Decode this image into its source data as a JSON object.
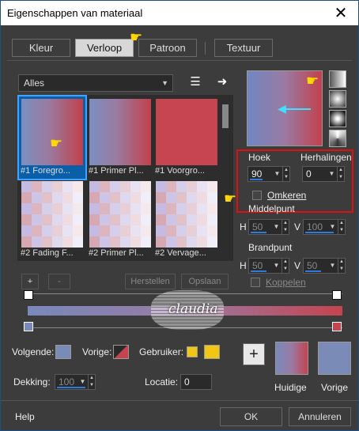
{
  "window": {
    "title": "Eigenschappen van materiaal",
    "close": "✕"
  },
  "tabs": [
    {
      "label": "Kleur",
      "active": false
    },
    {
      "label": "Verloop",
      "active": true
    },
    {
      "label": "Patroon",
      "active": false
    },
    {
      "label": "Textuur",
      "active": false
    }
  ],
  "gallery": {
    "filter": "Alles",
    "items": [
      {
        "label": "#1 Foregro..."
      },
      {
        "label": "#1 Primer Pl..."
      },
      {
        "label": "#1 Voorgro..."
      },
      {
        "label": "#2 Fading F..."
      },
      {
        "label": "#2 Primer Pl..."
      },
      {
        "label": "#2 Vervage..."
      }
    ],
    "add": "+",
    "remove": "-",
    "restore": "Herstellen",
    "save": "Opslaan"
  },
  "angle": {
    "label": "Hoek",
    "value": "90"
  },
  "repeats": {
    "label": "Herhalingen",
    "value": "0"
  },
  "reverse": {
    "label": "Omkeren",
    "checked": false
  },
  "center": {
    "label": "Middelpunt",
    "h_label": "H",
    "h": "50",
    "v_label": "V",
    "v": "100"
  },
  "focal": {
    "label": "Brandpunt",
    "h_label": "H",
    "h": "50",
    "v_label": "V",
    "v": "50"
  },
  "link": {
    "label": "Koppelen"
  },
  "bottom": {
    "next_label": "Volgende:",
    "prev_label": "Vorige:",
    "user_label": "Gebruiker:",
    "opacity_label": "Dekking:",
    "opacity_value": "100",
    "location_label": "Locatie:",
    "location_value": "0",
    "current_label": "Huidige",
    "previous_label": "Vorige"
  },
  "watermark": {
    "text": "claudia"
  },
  "buttons": {
    "help": "Help",
    "ok": "OK",
    "cancel": "Annuleren"
  },
  "colors": {
    "gradient_start": "#7889bb",
    "gradient_end": "#c4444f",
    "accent": "#2f7bdc",
    "user_yellow": "#f2c615",
    "highlight_red": "#e01010"
  }
}
